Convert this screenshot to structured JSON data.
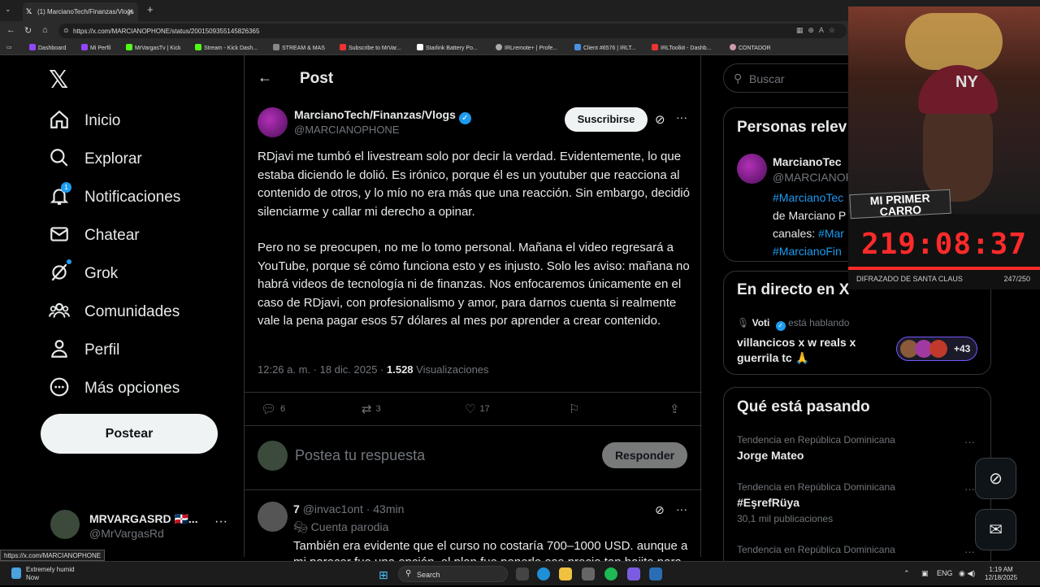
{
  "browser": {
    "tab_title": "(1) MarcianoTech/Finanzas/Vlogs",
    "url": "https://x.com/MARCIANOPHONE/status/2001509355145826365",
    "bookmarks": [
      "Dashboard",
      "Mi Perfil",
      "MrVargasTv | Kick",
      "Stream - Kick Dash...",
      "STREAM & MAS",
      "Subscribe to MrVar...",
      "Starlink Battery Po...",
      "IRLremote+ | Profe...",
      "Client #6576 | IRLT...",
      "IRLToolkit - Dashb...",
      "CONTADOR"
    ]
  },
  "sidebar": {
    "items": [
      {
        "label": "Inicio",
        "icon": "home-icon"
      },
      {
        "label": "Explorar",
        "icon": "search-icon"
      },
      {
        "label": "Notificaciones",
        "icon": "bell-icon",
        "badge": "1"
      },
      {
        "label": "Chatear",
        "icon": "mail-icon"
      },
      {
        "label": "Grok",
        "icon": "grok-icon"
      },
      {
        "label": "Comunidades",
        "icon": "people-icon"
      },
      {
        "label": "Perfil",
        "icon": "person-icon"
      },
      {
        "label": "Más opciones",
        "icon": "more-circle-icon"
      }
    ],
    "post_button": "Postear",
    "account": {
      "name": "MRVARGASRD 🇩🇴...",
      "handle": "@MrVargasRd"
    }
  },
  "main": {
    "title": "Post",
    "author": {
      "name": "MarcianoTech/Finanzas/Vlogs",
      "handle": "@MARCIANOPHONE"
    },
    "subscribe_button": "Suscribirse",
    "paragraphs": [
      "RDjavi me tumbó el livestream solo por decir la verdad. Evidentemente, lo que estaba diciendo le dolió. Es irónico, porque él es un youtuber que reacciona al contenido de otros, y lo mío no era más que una reacción. Sin embargo, decidió silenciarme y callar mi derecho a opinar.",
      "Pero no se preocupen, no me lo tomo personal. Mañana el video regresará a YouTube, porque sé cómo funciona esto y es injusto. Solo les aviso: mañana no habrá videos de tecnología ni de finanzas. Nos enfocaremos únicamente en el caso de RDjavi, con profesionalismo y amor, para darnos cuenta si realmente vale la pena pagar esos 57 dólares al mes por aprender a crear contenido."
    ],
    "timestamp": "12:26 a. m. · 18 dic. 2025 ·",
    "views_count": "1.528",
    "views_label": "Visualizaciones",
    "actions": {
      "replies": "6",
      "reposts": "3",
      "likes": "17"
    },
    "reply_placeholder": "Postea tu respuesta",
    "reply_button": "Responder",
    "reply": {
      "name": "7",
      "handle": "@invac1ont · 43min",
      "tag": "Cuenta parodia",
      "text": "También era evidente que el curso no costaría 700–1000 USD. aunque a mi parecer fue una opción, el plan fue ponerle ese precio tan bajito para no"
    }
  },
  "right": {
    "search_placeholder": "Buscar",
    "people": {
      "title": "Personas relev",
      "name": "MarcianoTec",
      "handle": "@MARCIANOP",
      "bio_1": "#MarcianoTec",
      "bio_2": "de Marciano P",
      "bio_3": "canales: ",
      "bio_3_tag": "#Mar",
      "bio_4": "#MarcianoFin"
    },
    "live": {
      "title": "En directo en X",
      "host": "Voti",
      "host_suffix": "está hablando",
      "space_title": "villancicos x w reals x guerrila tc 🙏",
      "listeners_more": "+43"
    },
    "trends": {
      "title": "Qué está pasando",
      "items": [
        {
          "meta": "Tendencia en República Dominicana",
          "name": "Jorge Mateo",
          "count": ""
        },
        {
          "meta": "Tendencia en República Dominicana",
          "name": "#EşrefRüya",
          "count": "30,1 mil publicaciones"
        },
        {
          "meta": "Tendencia en República Dominicana",
          "name": "",
          "count": ""
        }
      ]
    }
  },
  "overlay": {
    "banner": "MI PRIMER CARRO",
    "timer": "219:08:37",
    "label": "DIFRAZADO DE SANTA CLAUS",
    "count": "247/250"
  },
  "status_url": "https://x.com/MARCIANOPHONE",
  "taskbar": {
    "weather": "Extremely humid",
    "weather_sub": "Now",
    "search": "Search",
    "lang": "ENG",
    "time": "1:19 AM",
    "date": "12/18/2025"
  },
  "colors": {
    "accent": "#1d9bf0",
    "timer": "#ff2a2a",
    "background": "#000000"
  }
}
